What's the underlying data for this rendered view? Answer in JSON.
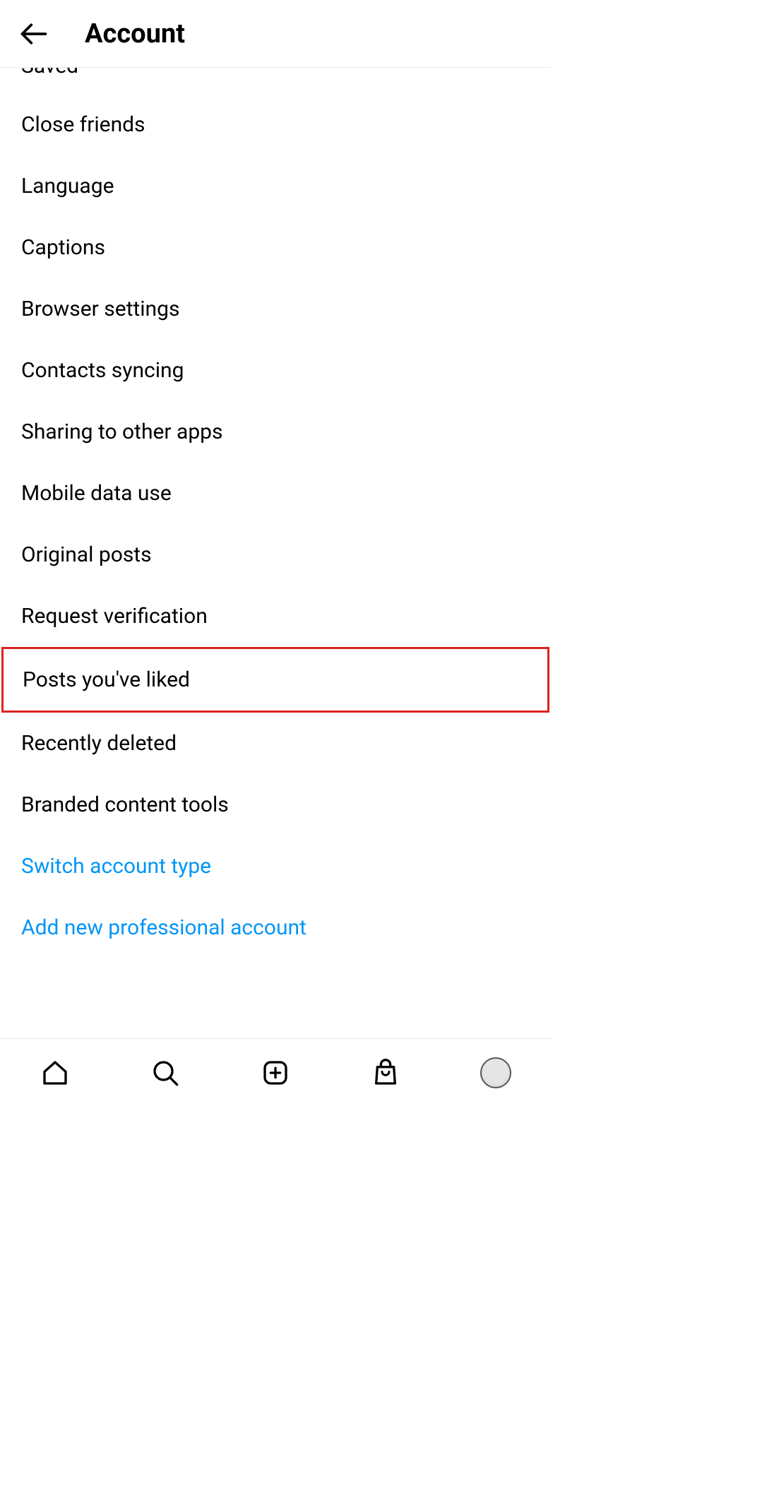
{
  "header": {
    "title": "Account"
  },
  "items": [
    {
      "label": "Saved",
      "link": false,
      "highlighted": false,
      "saved": true
    },
    {
      "label": "Close friends",
      "link": false,
      "highlighted": false
    },
    {
      "label": "Language",
      "link": false,
      "highlighted": false
    },
    {
      "label": "Captions",
      "link": false,
      "highlighted": false
    },
    {
      "label": "Browser settings",
      "link": false,
      "highlighted": false
    },
    {
      "label": "Contacts syncing",
      "link": false,
      "highlighted": false
    },
    {
      "label": "Sharing to other apps",
      "link": false,
      "highlighted": false
    },
    {
      "label": "Mobile data use",
      "link": false,
      "highlighted": false
    },
    {
      "label": "Original posts",
      "link": false,
      "highlighted": false
    },
    {
      "label": "Request verification",
      "link": false,
      "highlighted": false
    },
    {
      "label": "Posts you've liked",
      "link": false,
      "highlighted": true
    },
    {
      "label": "Recently deleted",
      "link": false,
      "highlighted": false
    },
    {
      "label": "Branded content tools",
      "link": false,
      "highlighted": false
    },
    {
      "label": "Switch account type",
      "link": true,
      "highlighted": false
    },
    {
      "label": "Add new professional account",
      "link": true,
      "highlighted": false
    }
  ],
  "nav": {
    "home": "home-icon",
    "search": "search-icon",
    "create": "create-icon",
    "shop": "shop-icon",
    "profile": "profile-icon"
  }
}
